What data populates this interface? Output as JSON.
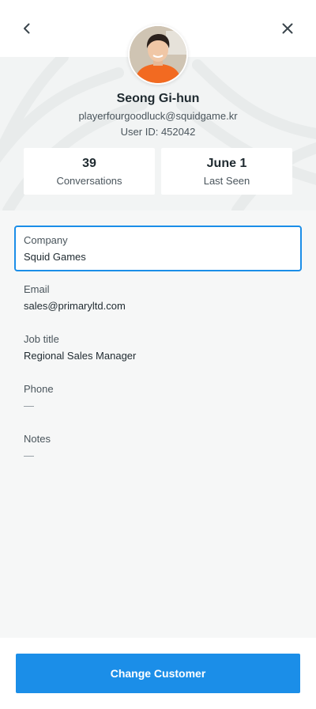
{
  "profile": {
    "name": "Seong Gi-hun",
    "email": "playerfourgoodluck@squidgame.kr",
    "user_id": "User ID: 452042",
    "avatar_icon": "person-avatar"
  },
  "nav": {
    "back_icon": "chevron-left-icon",
    "close_icon": "close-icon"
  },
  "stats": [
    {
      "value": "39",
      "label": "Conversations"
    },
    {
      "value": "June 1",
      "label": "Last Seen"
    }
  ],
  "fields": [
    {
      "label": "Company",
      "value": "Squid Games"
    },
    {
      "label": "Email",
      "value": "sales@primaryltd.com"
    },
    {
      "label": "Job title",
      "value": "Regional Sales Manager"
    },
    {
      "label": "Phone",
      "value": "—"
    },
    {
      "label": "Notes",
      "value": "—"
    }
  ],
  "footer": {
    "button_label": "Change Customer"
  },
  "colors": {
    "accent": "#1b8ee8",
    "text": "#1f2a30",
    "muted": "#4a555c",
    "background": "#f6f7f7"
  }
}
